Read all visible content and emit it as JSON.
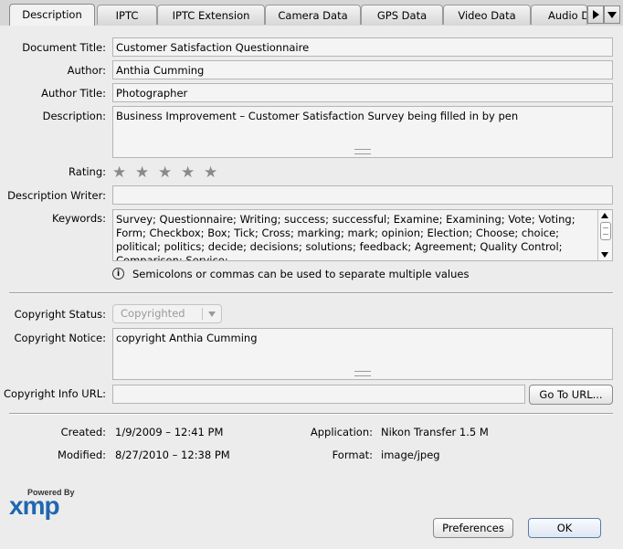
{
  "tabs": [
    "Description",
    "IPTC",
    "IPTC Extension",
    "Camera Data",
    "GPS Data",
    "Video Data",
    "Audio D"
  ],
  "labels": {
    "document_title": "Document Title:",
    "author": "Author:",
    "author_title": "Author Title:",
    "description": "Description:",
    "rating": "Rating:",
    "description_writer": "Description Writer:",
    "keywords": "Keywords:",
    "copyright_status": "Copyright Status:",
    "copyright_notice": "Copyright Notice:",
    "copyright_info_url": "Copyright Info URL:",
    "created": "Created:",
    "modified": "Modified:",
    "application": "Application:",
    "format": "Format:"
  },
  "values": {
    "document_title": "Customer Satisfaction Questionnaire",
    "author": "Anthia Cumming",
    "author_title": "Photographer",
    "description": "Business Improvement – Customer Satisfaction Survey being filled in by pen",
    "description_writer": "",
    "keywords": "Survey; Questionnaire; Writing; success; successful; Examine; Examining; Vote; Voting; Form; Checkbox; Box; Tick; Cross; marking; mark; opinion; Election; Choose; choice; political; politics; decide; decisions; solutions; feedback; Agreement; Quality Control; Comparison; Service;",
    "keywords_hint": "Semicolons or commas can be used to separate multiple values",
    "copyright_status": "Copyrighted",
    "copyright_notice": "copyright Anthia Cumming",
    "copyright_info_url": "",
    "created": "1/9/2009 – 12:41 PM",
    "modified": "8/27/2010 – 12:38 PM",
    "application": "Nikon Transfer 1.5 M",
    "format": "image/jpeg"
  },
  "rating": {
    "value": 0,
    "max": 5
  },
  "buttons": {
    "go_to_url": "Go To URL...",
    "preferences": "Preferences",
    "ok": "OK"
  },
  "logo": {
    "powered_by": "Powered By",
    "brand": "xmp"
  },
  "icons": {
    "tab_scroll_right": "triangle-right-icon",
    "tab_menu": "triangle-down-icon",
    "info": "info-icon",
    "star": "star-icon"
  }
}
